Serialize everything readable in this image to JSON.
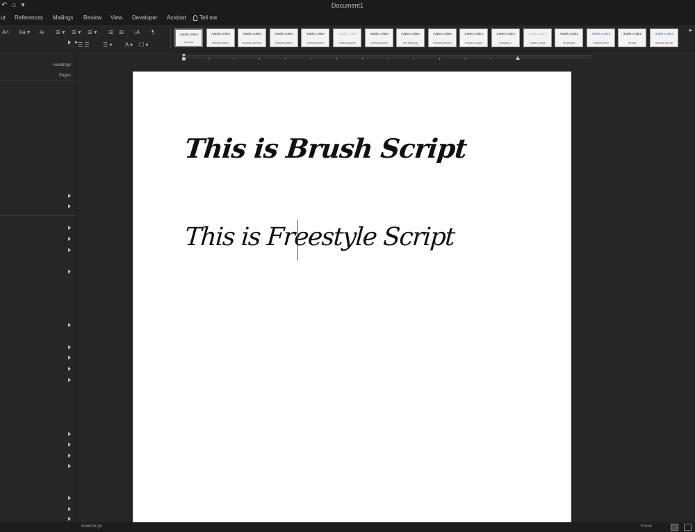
{
  "titlebar": {
    "document_title": "Document1",
    "quick_access": [
      "↶",
      "⌂",
      "▾"
    ]
  },
  "menu": {
    "tabs": [
      "ut",
      "References",
      "Mailings",
      "Review",
      "View",
      "Developer",
      "Acrobat"
    ],
    "tell_me": "Tell me"
  },
  "ribbon": {
    "font_size_increase": "A˄",
    "font_size_decrease": "Aa ▾",
    "clear_format": "A̷",
    "bullets": "☰ ▾",
    "numbering": "☰ ▾",
    "multilevel": "☰ ▾",
    "decrease_indent": "☰",
    "increase_indent": "☰",
    "sort": "↓A",
    "pilcrow": "¶",
    "align": "☰ ☰",
    "line_spacing": "☰ ▾",
    "shading": "A ▾",
    "borders": "☐ ▾",
    "more_styles": "▸",
    "styles": [
      {
        "sample": "AaBbCcDdEe",
        "name": "Normal",
        "variant": "selected"
      },
      {
        "sample": "AaBbCcDdEe",
        "name": "Default (Web)",
        "variant": ""
      },
      {
        "sample": "AaBbCcDdEe",
        "name": "Default (Author)",
        "variant": ""
      },
      {
        "sample": "AaBbCcDdEe",
        "name": "Default (Bold)",
        "variant": ""
      },
      {
        "sample": "AaBbCcDdEe",
        "name": "Default (Italic)",
        "variant": ""
      },
      {
        "sample": "AaBbCcDdEe",
        "name": "Default (Light)",
        "variant": "light"
      },
      {
        "sample": "AaBbCcDdEe",
        "name": "Default (Arial)",
        "variant": ""
      },
      {
        "sample": "AaBbCcDdEe",
        "name": "No Spacing",
        "variant": ""
      },
      {
        "sample": "AaBbCcDdEe",
        "name": "Default (Mono)",
        "variant": ""
      },
      {
        "sample": "AaBbCcDdEe",
        "name": "Default (Caps)",
        "variant": ""
      },
      {
        "sample": "AaBbCcDdEe",
        "name": "Heading 1",
        "variant": ""
      },
      {
        "sample": "AaBbCcDdEe",
        "name": "Subtle Emph",
        "variant": "light"
      },
      {
        "sample": "AaBbCcDdEe",
        "name": "Emphasis",
        "variant": ""
      },
      {
        "sample": "AaBbCcDdEe",
        "name": "Intense Emp",
        "variant": "blue"
      },
      {
        "sample": "AaBbCcDdEe",
        "name": "Strong",
        "variant": ""
      },
      {
        "sample": "AaBbCcDdEe",
        "name": "Intense Quote",
        "variant": "blue"
      }
    ]
  },
  "navpane": {
    "header_labels": [
      "Headings",
      "Pages"
    ]
  },
  "document": {
    "line1": "This is Brush Script",
    "line2": "This is Freestyle Script"
  },
  "statusbar": {
    "status_text": "Good to go",
    "focus_label": "Focus"
  }
}
